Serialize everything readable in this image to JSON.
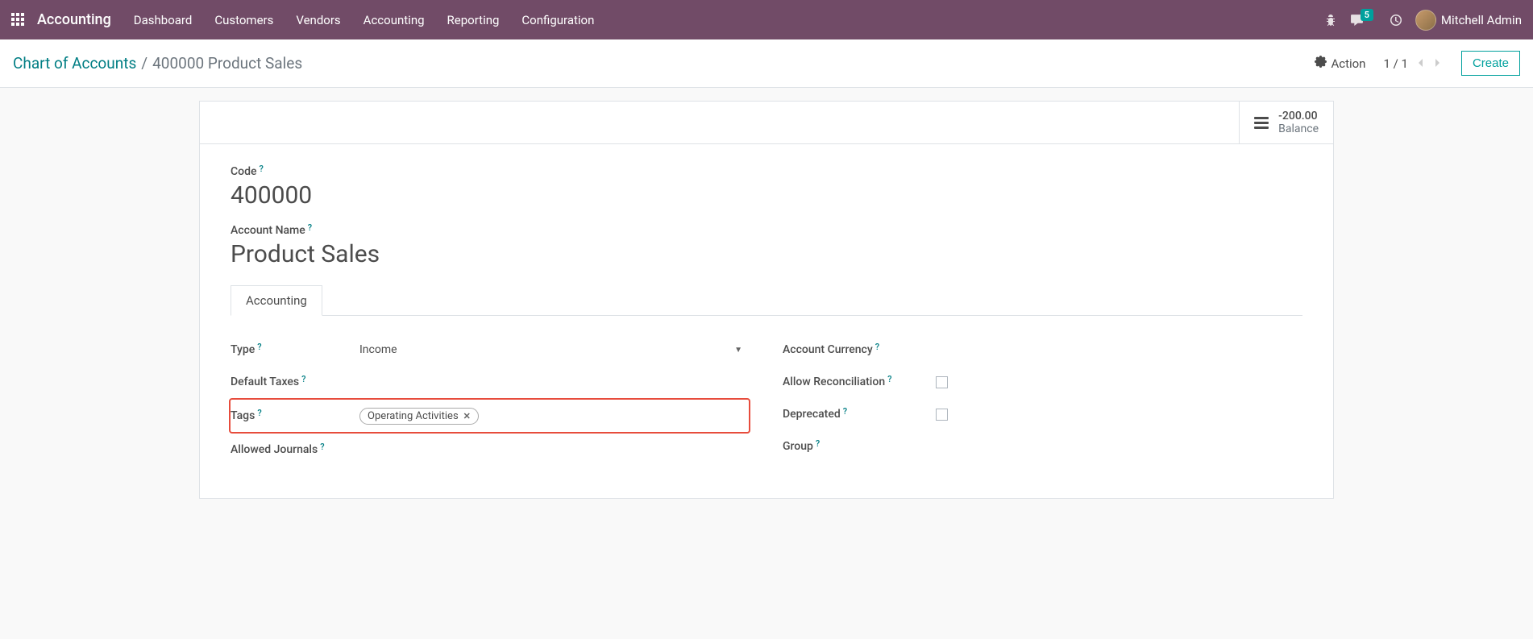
{
  "topnav": {
    "app_name": "Accounting",
    "items": [
      "Dashboard",
      "Customers",
      "Vendors",
      "Accounting",
      "Reporting",
      "Configuration"
    ],
    "notification_count": "5",
    "user_name": "Mitchell Admin"
  },
  "breadcrumb": {
    "parent": "Chart of Accounts",
    "sep": "/",
    "current": "400000 Product Sales"
  },
  "controls": {
    "action_label": "Action",
    "pager": "1 / 1",
    "create_label": "Create"
  },
  "balance": {
    "value": "-200.00",
    "label": "Balance"
  },
  "form": {
    "code_label": "Code",
    "code_value": "400000",
    "name_label": "Account Name",
    "name_value": "Product Sales"
  },
  "tab": {
    "accounting_label": "Accounting"
  },
  "left_fields": {
    "type_label": "Type",
    "type_value": "Income",
    "default_taxes_label": "Default Taxes",
    "tags_label": "Tags",
    "tag_value": "Operating Activities",
    "allowed_journals_label": "Allowed Journals"
  },
  "right_fields": {
    "currency_label": "Account Currency",
    "allow_recon_label": "Allow Reconciliation",
    "deprecated_label": "Deprecated",
    "group_label": "Group"
  }
}
